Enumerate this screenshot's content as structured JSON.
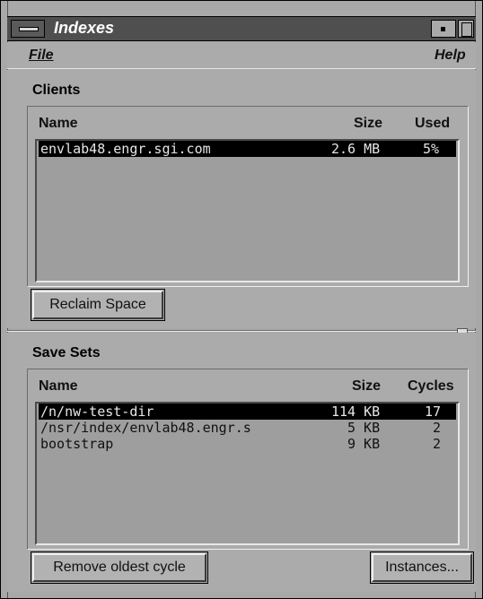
{
  "window": {
    "title": "Indexes"
  },
  "menubar": {
    "file": "File",
    "help": "Help"
  },
  "clients": {
    "section_title": "Clients",
    "columns": {
      "name": "Name",
      "size": "Size",
      "used": "Used"
    },
    "rows": [
      {
        "name": "envlab48.engr.sgi.com",
        "size": "2.6 MB",
        "used": "5%",
        "selected": true
      }
    ],
    "reclaim_button": "Reclaim Space"
  },
  "save_sets": {
    "section_title": "Save Sets",
    "columns": {
      "name": "Name",
      "size": "Size",
      "cycles": "Cycles"
    },
    "rows": [
      {
        "name": "/n/nw-test-dir",
        "size": "114 KB",
        "cycles": "17",
        "selected": true
      },
      {
        "name": "/nsr/index/envlab48.engr.s",
        "size": "5 KB",
        "cycles": "2",
        "selected": false
      },
      {
        "name": "bootstrap",
        "size": "9 KB",
        "cycles": "2",
        "selected": false
      }
    ],
    "remove_button": "Remove oldest cycle",
    "instances_button": "Instances..."
  },
  "icons": {
    "window_menu": "window-menu-icon",
    "minimize": "minimize-icon",
    "maximize": "maximize-icon",
    "sash": "pane-sash-icon"
  }
}
